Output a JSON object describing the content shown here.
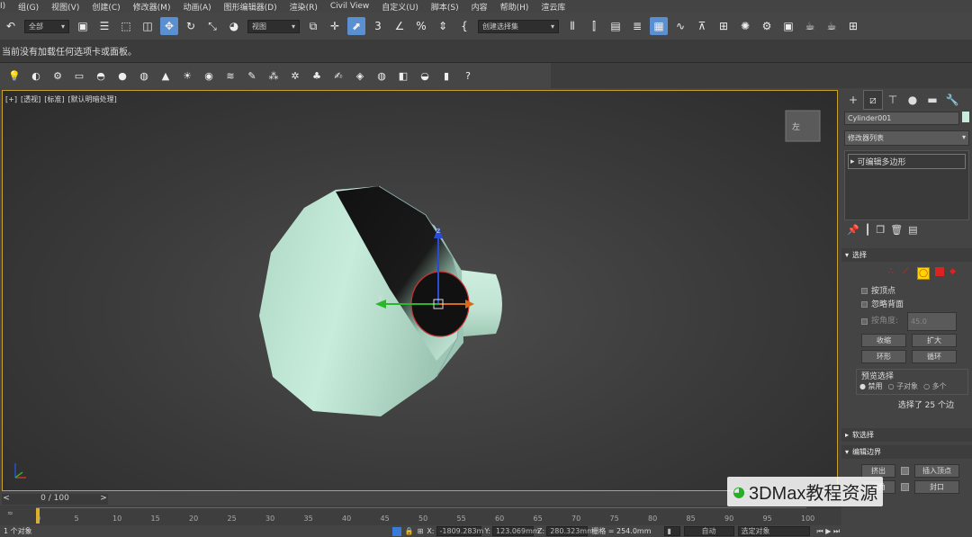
{
  "menu": [
    "I)",
    "组(G)",
    "视图(V)",
    "创建(C)",
    "修改器(M)",
    "动画(A)",
    "图形编辑器(D)",
    "渲染(R)",
    "Civil View",
    "自定义(U)",
    "脚本(S)",
    "内容",
    "帮助(H)",
    "渲云库"
  ],
  "toolbar": {
    "filter_value": "全部",
    "refcoord_value": "视图",
    "named_selection_value": "创建选择集"
  },
  "ribbon_message": "当前没有加载任何选项卡或面板。",
  "viewport": {
    "labels": [
      "[+]",
      "[透视]",
      "[标准]",
      "[默认明暗处理]"
    ],
    "viewcube_label": "左"
  },
  "panel": {
    "object_name": "Cylinder001",
    "modifier_list_label": "修改器列表",
    "stack_item": "可编辑多边形",
    "selection": {
      "title": "选择",
      "by_vertex": "按顶点",
      "ignore_backfacing": "忽略背面",
      "by_angle": "按角度:",
      "angle_value": "45.0",
      "shrink": "收缩",
      "grow": "扩大",
      "ring": "环形",
      "loop": "循环",
      "preview_title": "预览选择",
      "preview_disabled": "禁用",
      "preview_subobj": "子对象",
      "preview_multi": "多个",
      "status": "选择了 25 个边"
    },
    "soft_selection": "软选择",
    "edit_edges": {
      "title": "编辑边界",
      "extrude": "挤出",
      "insert_vertex": "插入顶点",
      "chamfer": "切角",
      "cap": "封口"
    }
  },
  "timeline": {
    "frame": "0 / 100",
    "ticks": [
      "0",
      "5",
      "10",
      "15",
      "20",
      "25",
      "30",
      "35",
      "40",
      "45",
      "50",
      "55",
      "60",
      "65",
      "70",
      "75",
      "80",
      "85",
      "90",
      "95",
      "100"
    ]
  },
  "status": {
    "selected": "1 个对象",
    "x_label": "X:",
    "x_value": "-1809.283m",
    "y_label": "Y:",
    "y_value": "123.069mm",
    "z_label": "Z:",
    "z_value": "280.323mm",
    "grid": "栅格 = 254.0mm",
    "auto": "自动",
    "sel_obj": "选定对象"
  },
  "watermark": "3DMax教程资源"
}
